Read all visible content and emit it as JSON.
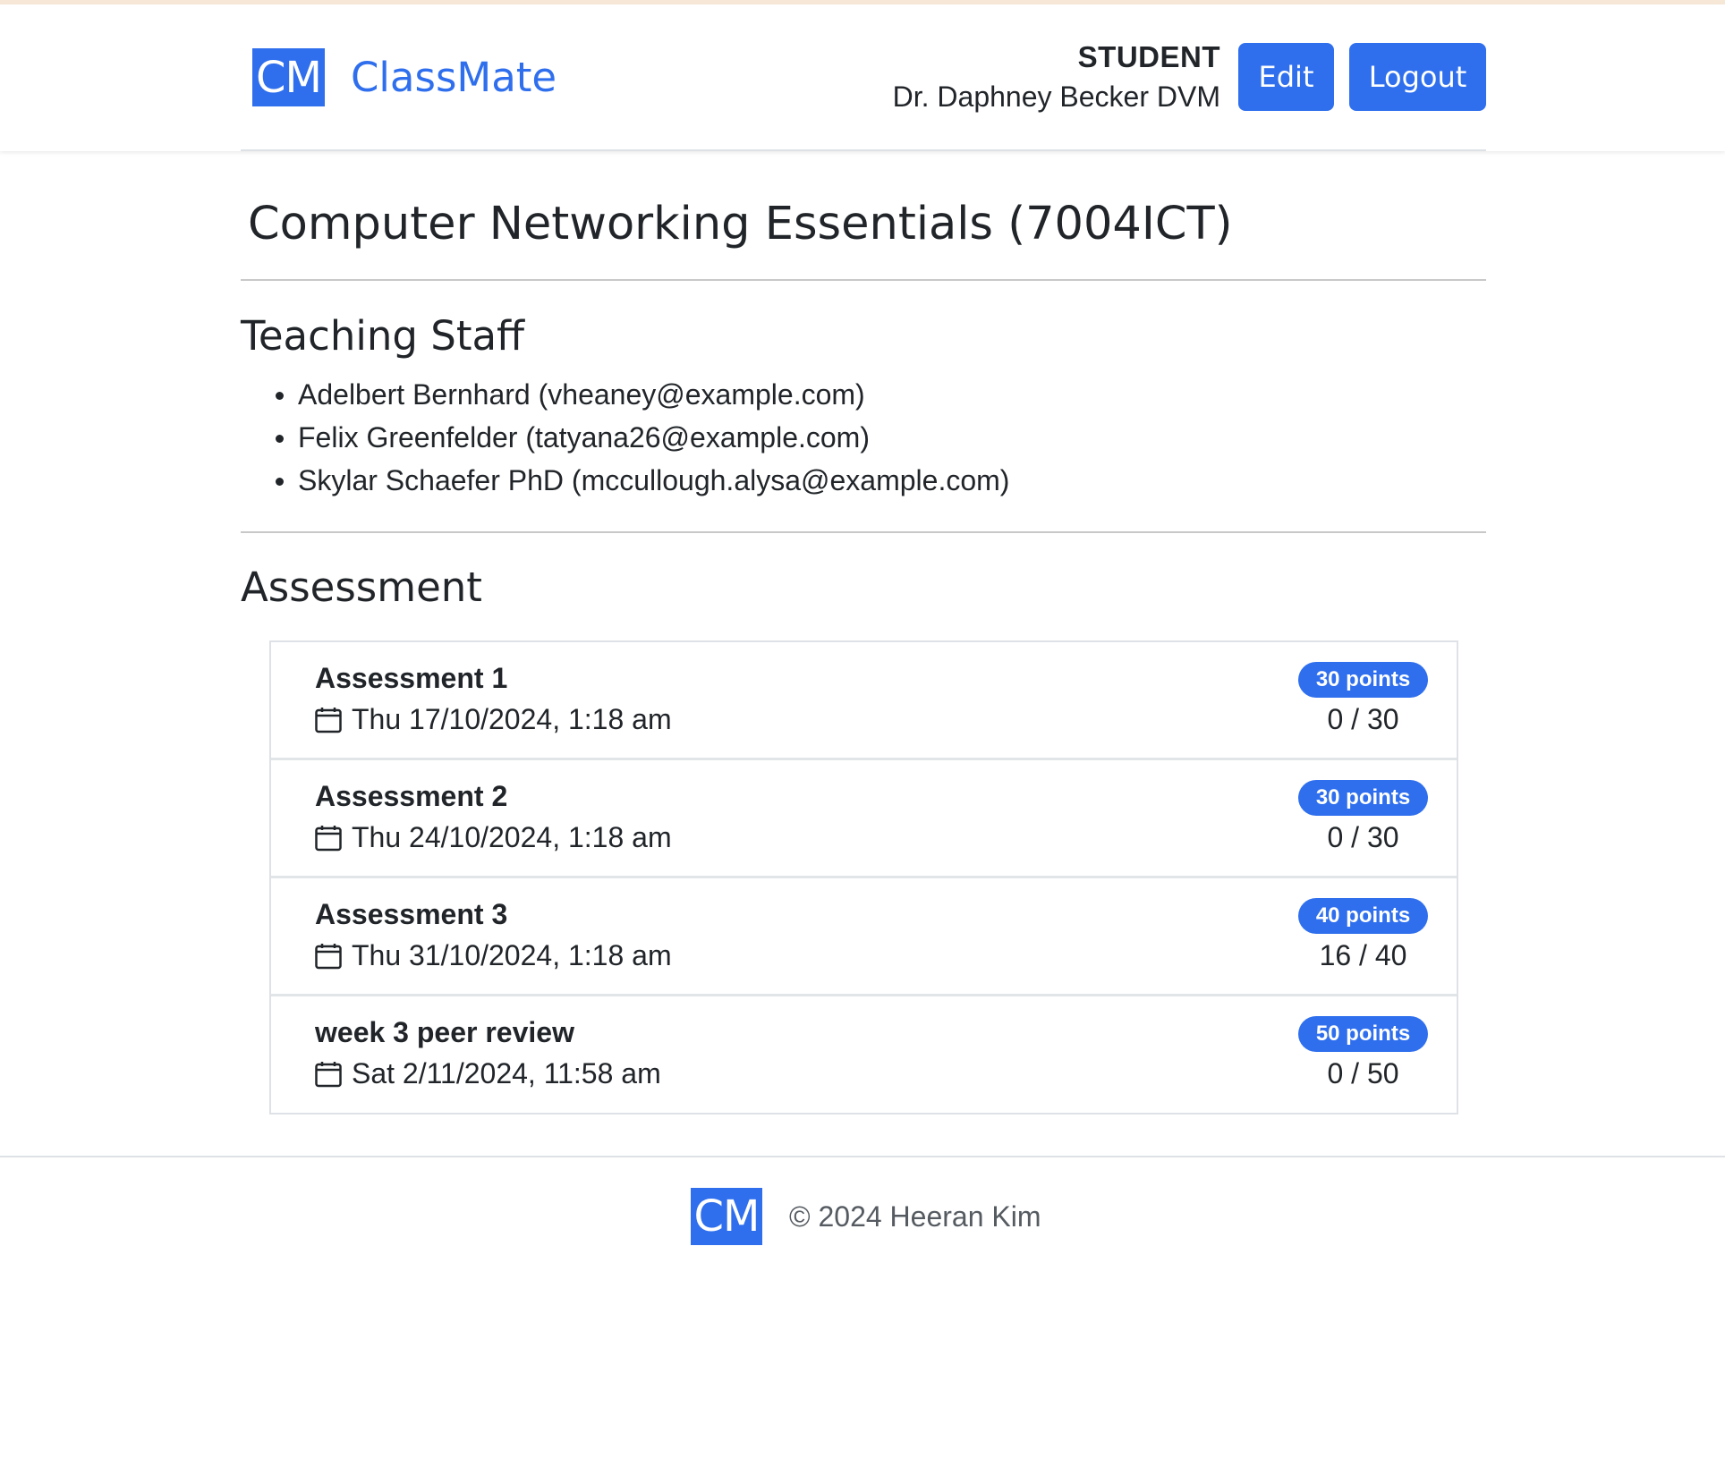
{
  "header": {
    "logo_text": "CM",
    "brand": "ClassMate",
    "role": "STUDENT",
    "user_name": "Dr. Daphney Becker DVM",
    "edit_label": "Edit",
    "logout_label": "Logout"
  },
  "course": {
    "title": "Computer Networking Essentials (7004ICT)"
  },
  "staff": {
    "heading": "Teaching Staff",
    "members": [
      "Adelbert Bernhard (vheaney@example.com)",
      "Felix Greenfelder (tatyana26@example.com)",
      "Skylar Schaefer PhD (mccullough.alysa@example.com)"
    ]
  },
  "assessment": {
    "heading": "Assessment",
    "items": [
      {
        "title": "Assessment 1",
        "date": "Thu 17/10/2024, 1:18 am",
        "points": "30 points",
        "score": "0 / 30"
      },
      {
        "title": "Assessment 2",
        "date": "Thu 24/10/2024, 1:18 am",
        "points": "30 points",
        "score": "0 / 30"
      },
      {
        "title": "Assessment 3",
        "date": "Thu 31/10/2024, 1:18 am",
        "points": "40 points",
        "score": "16 / 40"
      },
      {
        "title": "week 3 peer review",
        "date": "Sat 2/11/2024, 11:58 am",
        "points": "50 points",
        "score": "0 / 50"
      }
    ],
    "date_icon": "calendar-icon"
  },
  "footer": {
    "logo_text": "CM",
    "copyright": "© 2024 Heeran Kim"
  },
  "colors": {
    "accent": "#2f6fed",
    "text": "#212529",
    "muted": "#555b61",
    "divider": "#dee2e6"
  }
}
